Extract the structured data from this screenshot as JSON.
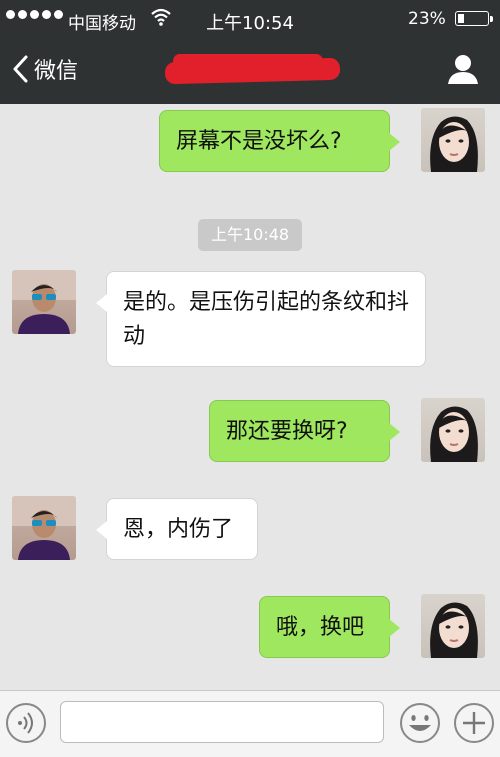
{
  "status_bar": {
    "carrier": "中国移动",
    "time": "上午10:54",
    "battery_percent": "23%",
    "battery_level": 0.23
  },
  "nav": {
    "back_label": "微信",
    "back_icon": "chevron-left-icon",
    "profile_icon": "person-icon"
  },
  "chat": {
    "timestamp": "上午10:48",
    "messages": [
      {
        "side": "sent",
        "text": "屏幕不是没坏么?"
      },
      {
        "side": "recv",
        "text": "是的。是压伤引起的条纹和抖动"
      },
      {
        "side": "sent",
        "text": "那还要换呀?"
      },
      {
        "side": "recv",
        "text": "恩，内伤了"
      },
      {
        "side": "sent",
        "text": "哦，换吧"
      }
    ]
  },
  "input_bar": {
    "voice_icon": "voice-icon",
    "emoji_icon": "emoji-icon",
    "plus_icon": "plus-icon",
    "input_value": ""
  },
  "colors": {
    "header_bg": "#2f3233",
    "sent_bubble": "#9fe75e",
    "recv_bubble": "#ffffff",
    "chat_bg": "#e6e6e6"
  }
}
